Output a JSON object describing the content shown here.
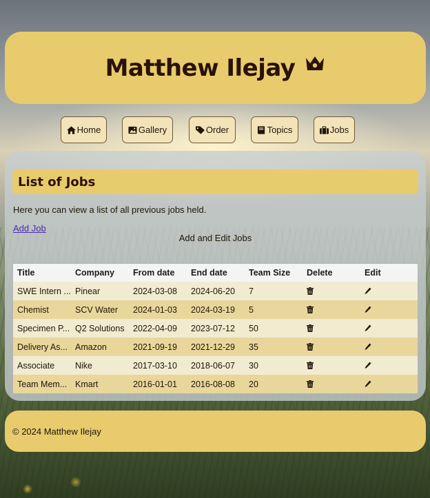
{
  "header": {
    "title": "Matthew Ilejay",
    "crown_icon": "crown-icon"
  },
  "nav": {
    "items": [
      {
        "label": "Home",
        "icon": "home-icon"
      },
      {
        "label": "Gallery",
        "icon": "image-icon"
      },
      {
        "label": "Order",
        "icon": "tag-icon"
      },
      {
        "label": "Topics",
        "icon": "book-icon"
      },
      {
        "label": "Jobs",
        "icon": "briefcase-icon"
      }
    ]
  },
  "main": {
    "section_title": "List of Jobs",
    "intro": "Here you can view a list of all previous jobs held.",
    "add_link": "Add Job",
    "caption": "Add and Edit Jobs",
    "table": {
      "headers": [
        "Title",
        "Company",
        "From date",
        "End date",
        "Team Size",
        "Delete",
        "Edit"
      ],
      "rows": [
        {
          "title": "SWE Intern ...",
          "company": "Pinear",
          "from": "2024-03-08",
          "end": "2024-06-20",
          "team": "7"
        },
        {
          "title": "Chemist",
          "company": "SCV Water",
          "from": "2024-01-03",
          "end": "2024-03-19",
          "team": "5"
        },
        {
          "title": "Specimen P...",
          "company": "Q2 Solutions",
          "from": "2022-04-09",
          "end": "2023-07-12",
          "team": "50"
        },
        {
          "title": "Delivery As...",
          "company": "Amazon",
          "from": "2021-09-19",
          "end": "2021-12-29",
          "team": "35"
        },
        {
          "title": "Associate",
          "company": "Nike",
          "from": "2017-03-10",
          "end": "2018-06-07",
          "team": "30"
        },
        {
          "title": "Team Mem...",
          "company": "Kmart",
          "from": "2016-01-01",
          "end": "2016-08-08",
          "team": "20"
        }
      ]
    }
  },
  "footer": {
    "text": "© 2024 Matthew Ilejay"
  },
  "colors": {
    "accent": "#e8cb6c",
    "nav_button": "#f3e3b8",
    "row_odd": "#f1ebd2",
    "row_even": "#e9d69b",
    "link": "#4a2bb0"
  }
}
